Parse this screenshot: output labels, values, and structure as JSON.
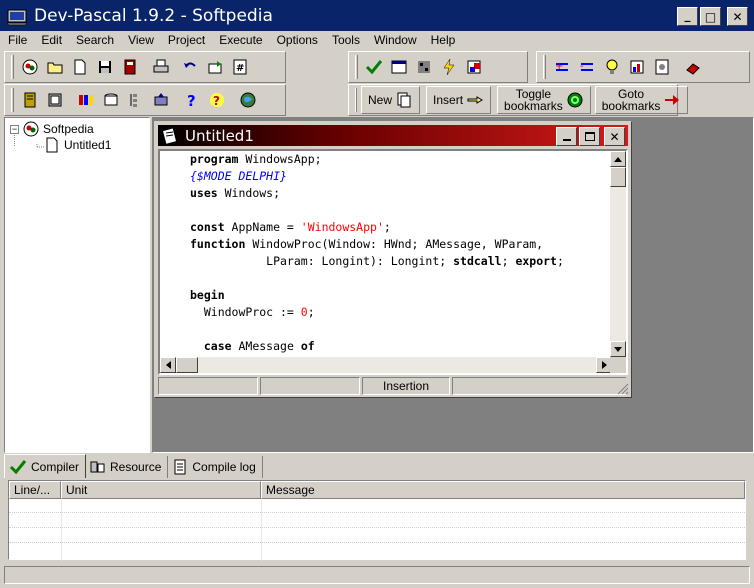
{
  "window": {
    "title": "Dev-Pascal 1.9.2 - Softpedia",
    "minimize": "_",
    "maximize": "□",
    "close": "✕"
  },
  "menu": [
    "File",
    "Edit",
    "Search",
    "View",
    "Project",
    "Execute",
    "Options",
    "Tools",
    "Window",
    "Help"
  ],
  "toolbar": {
    "new_label": "New",
    "insert_label": "Insert",
    "toggle_bookmarks_label": "Toggle\nbookmarks",
    "goto_bookmarks_label": "Goto\nbookmarks"
  },
  "tree": {
    "root": "Softpedia",
    "child": "Untitled1"
  },
  "editor_window": {
    "title": "Untitled1",
    "status_mode": "Insertion"
  },
  "code_lines": [
    [
      {
        "t": "program",
        "c": "kw"
      },
      {
        "t": " WindowsApp;",
        "c": ""
      }
    ],
    [
      {
        "t": "{$MODE DELPHI}",
        "c": "cmt"
      }
    ],
    [
      {
        "t": "uses",
        "c": "kw"
      },
      {
        "t": " Windows;",
        "c": ""
      }
    ],
    [],
    [
      {
        "t": "const",
        "c": "kw"
      },
      {
        "t": " AppName = ",
        "c": ""
      },
      {
        "t": "'WindowsApp'",
        "c": "str"
      },
      {
        "t": ";",
        "c": ""
      }
    ],
    [
      {
        "t": "function",
        "c": "kw"
      },
      {
        "t": " WindowProc(Window: HWnd; AMessage, WParam,",
        "c": ""
      }
    ],
    [
      {
        "t": "           LParam: Longint): Longint; ",
        "c": ""
      },
      {
        "t": "stdcall",
        "c": "kw"
      },
      {
        "t": "; ",
        "c": ""
      },
      {
        "t": "export",
        "c": "kw"
      },
      {
        "t": ";",
        "c": ""
      }
    ],
    [],
    [
      {
        "t": "begin",
        "c": "kw"
      }
    ],
    [
      {
        "t": "  WindowProc := ",
        "c": ""
      },
      {
        "t": "0",
        "c": "num"
      },
      {
        "t": ";",
        "c": ""
      }
    ],
    [],
    [
      {
        "t": "  ",
        "c": ""
      },
      {
        "t": "case",
        "c": "kw"
      },
      {
        "t": " AMessage ",
        "c": ""
      },
      {
        "t": "of",
        "c": "kw"
      }
    ]
  ],
  "bottom_tabs": [
    "Compiler",
    "Resource",
    "Compile log"
  ],
  "message_columns": [
    "Line/...",
    "Unit",
    "Message"
  ],
  "colors": {
    "titlebar": "#0a246a",
    "child_title_start": "#000000",
    "child_title_end": "#d61a1a",
    "keyword": "#000000",
    "string": "#ff0000",
    "comment": "#0000ff"
  }
}
